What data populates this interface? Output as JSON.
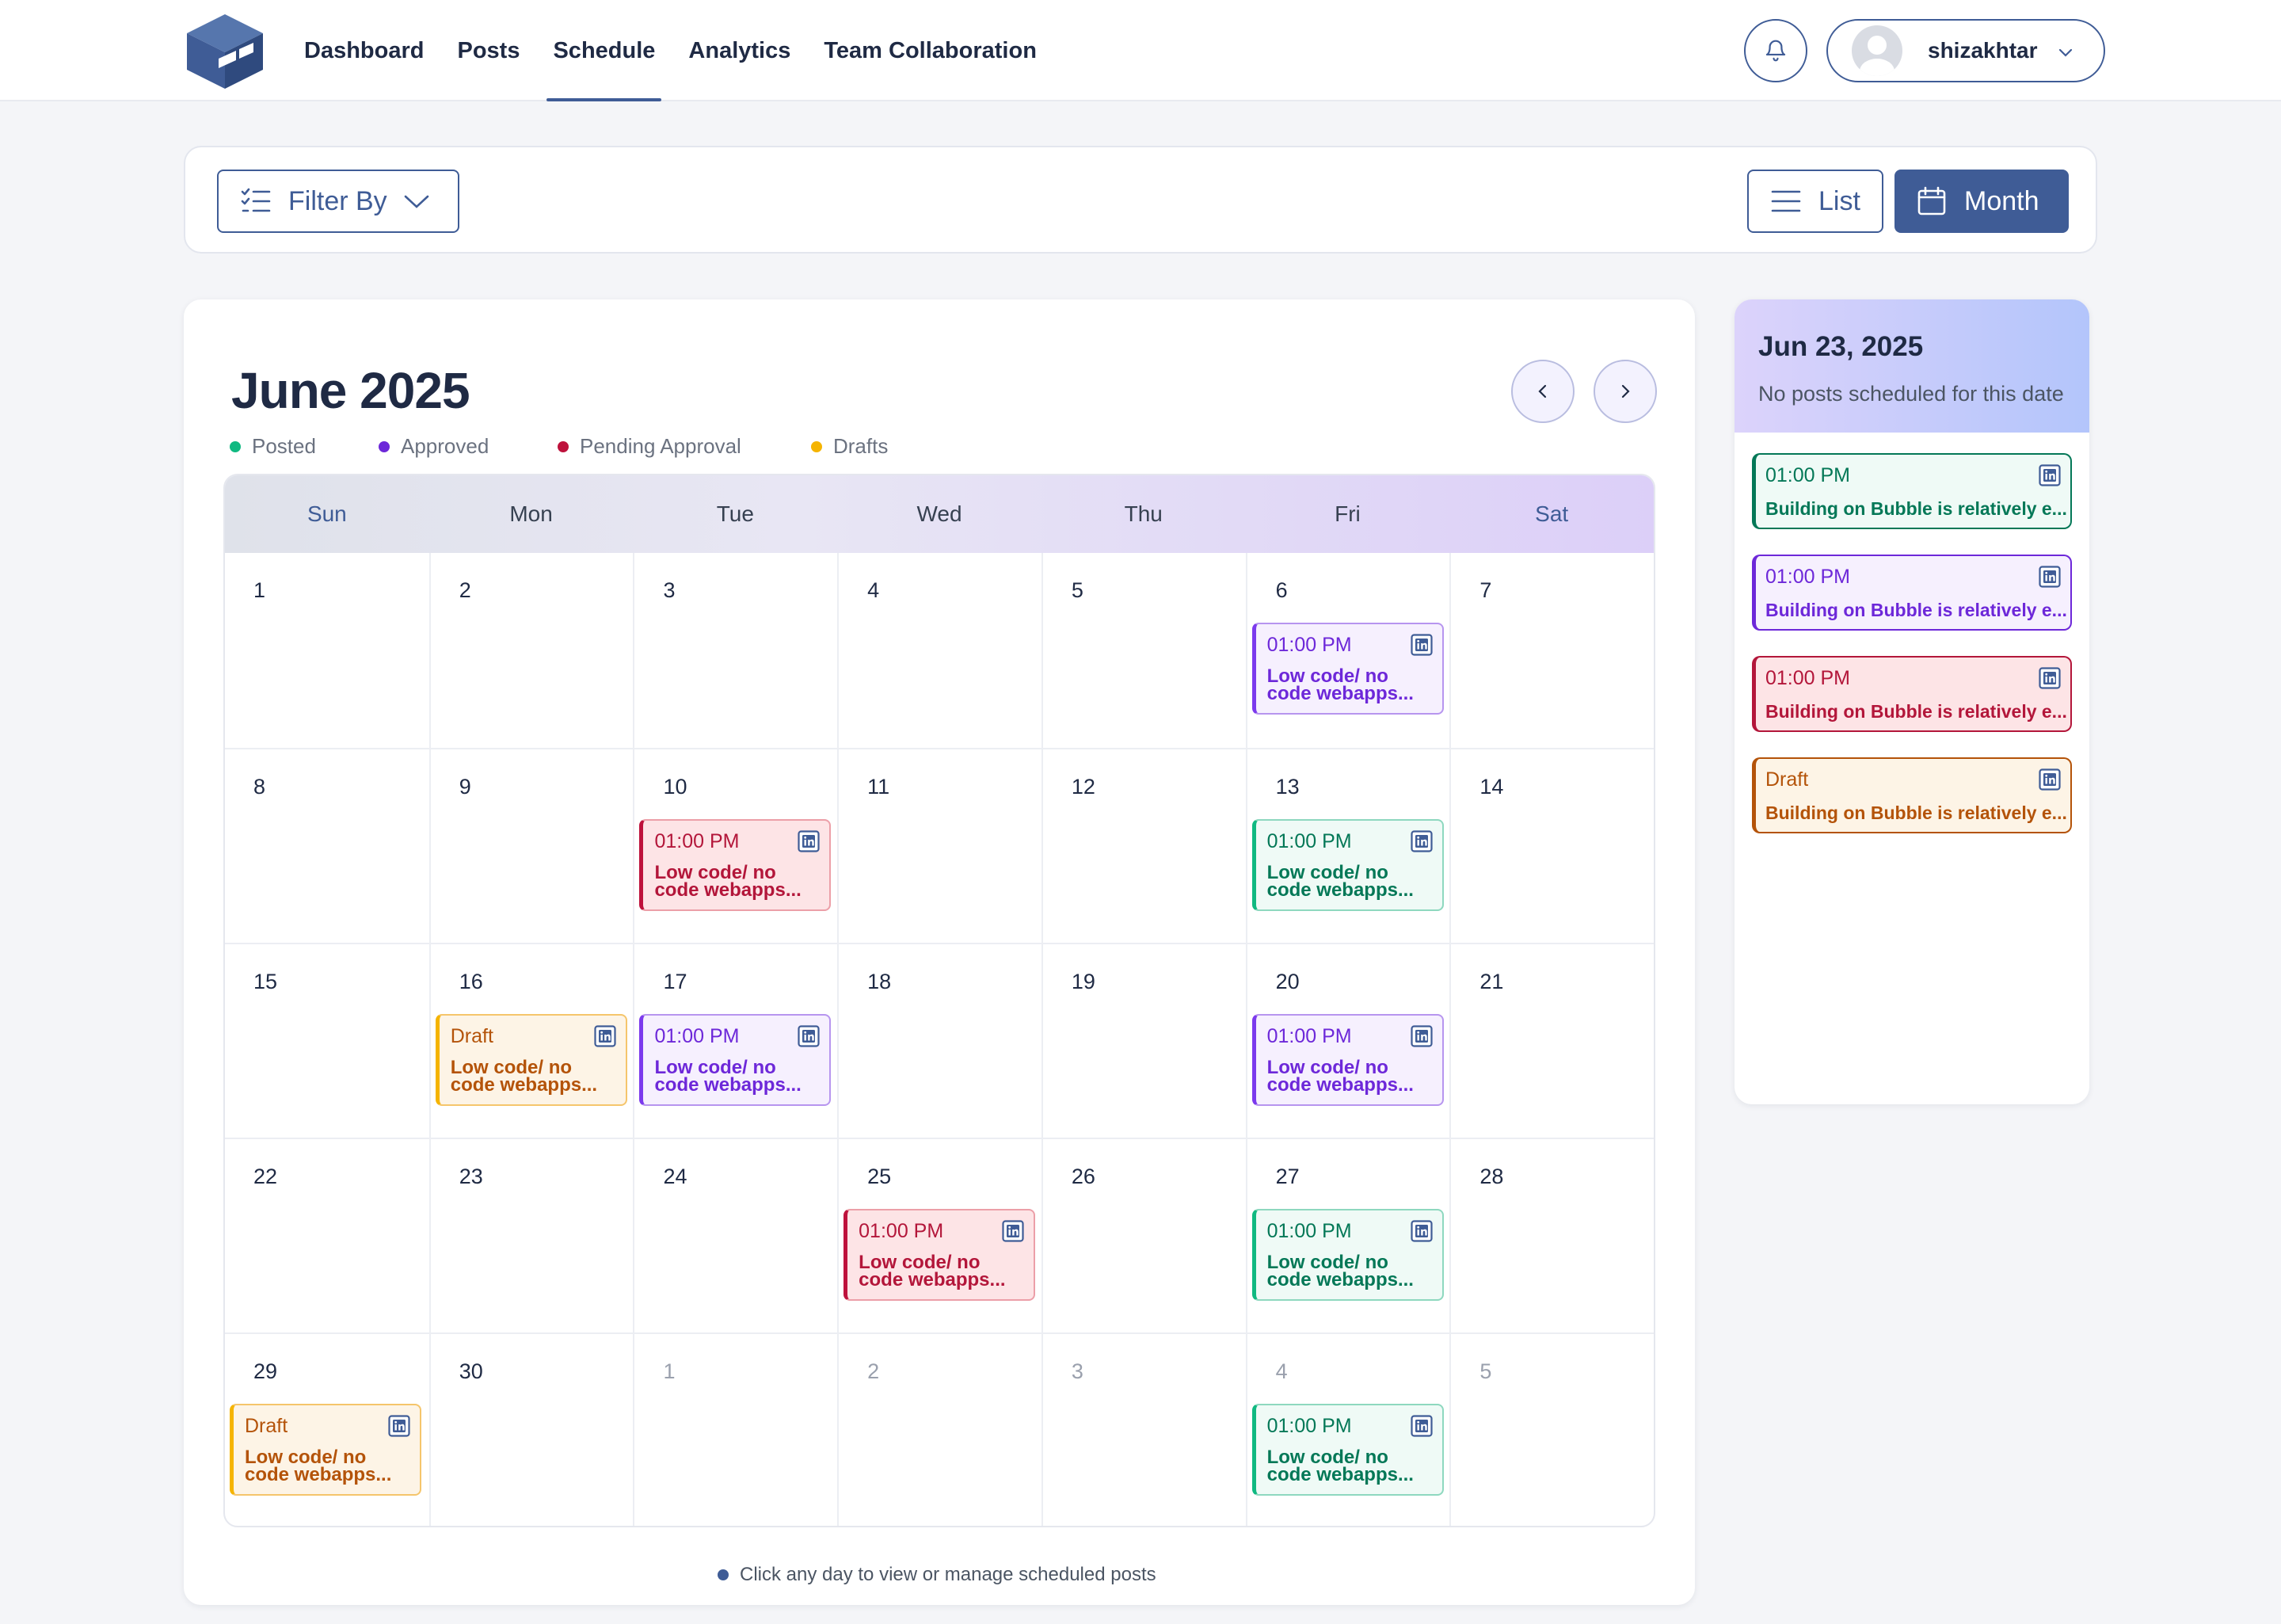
{
  "nav": {
    "items": [
      {
        "label": "Dashboard",
        "active": false
      },
      {
        "label": "Posts",
        "active": false
      },
      {
        "label": "Schedule",
        "active": true
      },
      {
        "label": "Analytics",
        "active": false
      },
      {
        "label": "Team Collaboration",
        "active": false
      }
    ]
  },
  "user": {
    "name": "shizakhtar"
  },
  "toolbar": {
    "filter_label": "Filter By",
    "list_label": "List",
    "month_label": "Month"
  },
  "calendar": {
    "title": "June 2025",
    "legend": [
      {
        "label": "Posted",
        "color": "#10b981"
      },
      {
        "label": "Approved",
        "color": "#6d28d9"
      },
      {
        "label": "Pending Approval",
        "color": "#be123c"
      },
      {
        "label": "Drafts",
        "color": "#f5b400"
      }
    ],
    "weekdays": [
      "Sun",
      "Mon",
      "Tue",
      "Wed",
      "Thu",
      "Fri",
      "Sat"
    ],
    "weeks": [
      [
        {
          "day": "1",
          "muted": false
        },
        {
          "day": "2",
          "muted": false
        },
        {
          "day": "3",
          "muted": false
        },
        {
          "day": "4",
          "muted": false
        },
        {
          "day": "5",
          "muted": false
        },
        {
          "day": "6",
          "muted": false,
          "post": {
            "status": "approved",
            "time": "01:00 PM",
            "text": "Low code/ no code webapps..."
          }
        },
        {
          "day": "7",
          "muted": false
        }
      ],
      [
        {
          "day": "8",
          "muted": false
        },
        {
          "day": "9",
          "muted": false
        },
        {
          "day": "10",
          "muted": false,
          "post": {
            "status": "pending",
            "time": "01:00 PM",
            "text": "Low code/ no code webapps..."
          }
        },
        {
          "day": "11",
          "muted": false
        },
        {
          "day": "12",
          "muted": false
        },
        {
          "day": "13",
          "muted": false,
          "post": {
            "status": "posted",
            "time": "01:00 PM",
            "text": "Low code/ no code webapps..."
          }
        },
        {
          "day": "14",
          "muted": false
        }
      ],
      [
        {
          "day": "15",
          "muted": false
        },
        {
          "day": "16",
          "muted": false,
          "post": {
            "status": "draft",
            "time": "Draft",
            "text": "Low code/ no code webapps..."
          }
        },
        {
          "day": "17",
          "muted": false,
          "post": {
            "status": "approved",
            "time": "01:00 PM",
            "text": "Low code/ no code webapps..."
          }
        },
        {
          "day": "18",
          "muted": false
        },
        {
          "day": "19",
          "muted": false
        },
        {
          "day": "20",
          "muted": false,
          "post": {
            "status": "approved",
            "time": "01:00 PM",
            "text": "Low code/ no code webapps..."
          }
        },
        {
          "day": "21",
          "muted": false
        }
      ],
      [
        {
          "day": "22",
          "muted": false
        },
        {
          "day": "23",
          "muted": false
        },
        {
          "day": "24",
          "muted": false
        },
        {
          "day": "25",
          "muted": false,
          "post": {
            "status": "pending",
            "time": "01:00 PM",
            "text": "Low code/ no code webapps..."
          }
        },
        {
          "day": "26",
          "muted": false
        },
        {
          "day": "27",
          "muted": false,
          "post": {
            "status": "posted",
            "time": "01:00 PM",
            "text": "Low code/ no code webapps..."
          }
        },
        {
          "day": "28",
          "muted": false
        }
      ],
      [
        {
          "day": "29",
          "muted": false,
          "post": {
            "status": "draft",
            "time": "Draft",
            "text": "Low code/ no code webapps..."
          }
        },
        {
          "day": "30",
          "muted": false
        },
        {
          "day": "1",
          "muted": true
        },
        {
          "day": "2",
          "muted": true
        },
        {
          "day": "3",
          "muted": true
        },
        {
          "day": "4",
          "muted": true,
          "post": {
            "status": "posted",
            "time": "01:00 PM",
            "text": "Low code/ no code webapps..."
          }
        },
        {
          "day": "5",
          "muted": true
        }
      ]
    ],
    "hint": "Click any day to view or manage scheduled posts"
  },
  "side_panel": {
    "date": "Jun 23, 2025",
    "subtitle": "No posts scheduled for this date",
    "posts": [
      {
        "status": "posted",
        "time": "01:00 PM",
        "text": "Building on Bubble is relatively e..."
      },
      {
        "status": "approved",
        "time": "01:00 PM",
        "text": "Building on Bubble is relatively e..."
      },
      {
        "status": "pending",
        "time": "01:00 PM",
        "text": "Building on Bubble is relatively e..."
      },
      {
        "status": "draft",
        "time": "Draft",
        "text": "Building on Bubble is relatively e..."
      }
    ]
  },
  "colors": {
    "accent": "#3f5c96",
    "posted": "#10b981",
    "approved": "#6d28d9",
    "pending": "#be123c",
    "draft": "#f5b400"
  }
}
